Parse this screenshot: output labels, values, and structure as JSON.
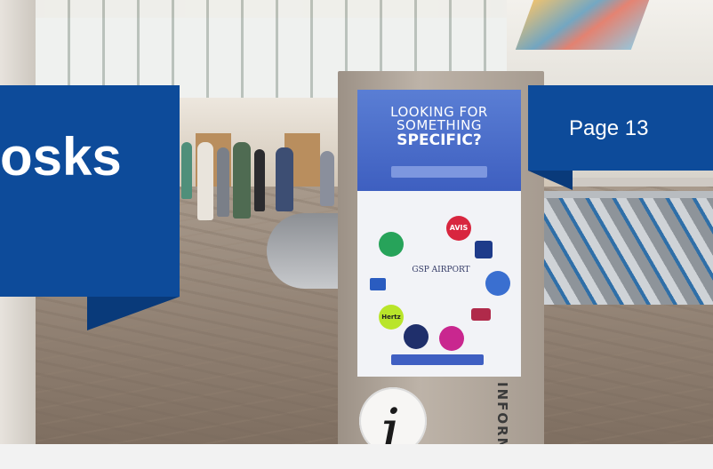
{
  "overlay": {
    "title": "osks",
    "page_label": "Page 13"
  },
  "kiosk": {
    "headline_line1": "LOOKING FOR",
    "headline_line2": "SOMETHING",
    "headline_line3": "SPECIFIC?",
    "center_logo_text": "GSP AIRPORT",
    "logo_avis": "AVIS",
    "logo_hertz": "Hertz",
    "side_label": "INFORM",
    "info_glyph": "i"
  },
  "colors": {
    "accent_blue": "#0d4b9a",
    "screen_blue": "#3e5fc0"
  }
}
